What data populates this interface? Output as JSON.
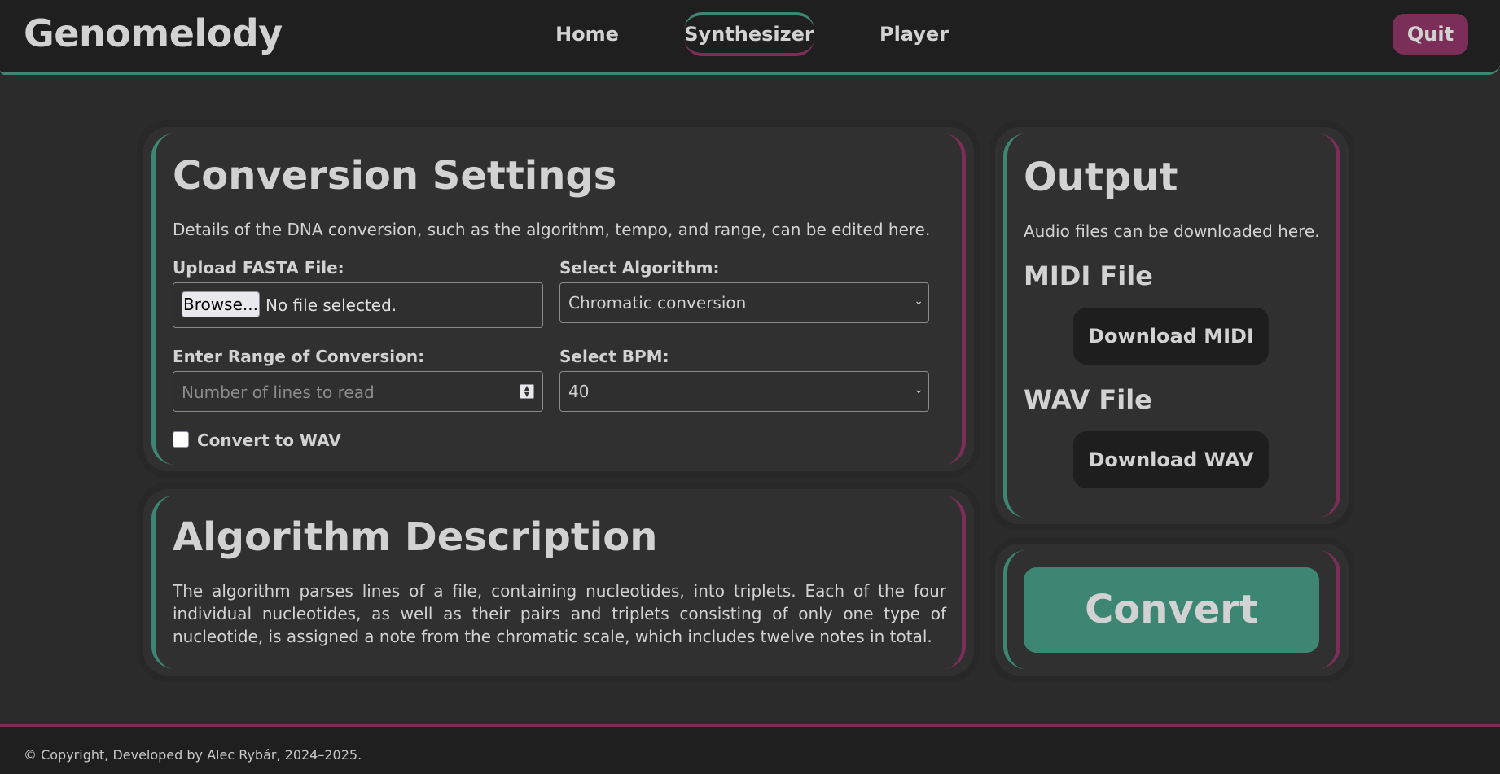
{
  "header": {
    "logo": "Genomelody",
    "nav": [
      {
        "label": "Home"
      },
      {
        "label": "Synthesizer",
        "active": true
      },
      {
        "label": "Player"
      }
    ],
    "quit_label": "Quit"
  },
  "settings": {
    "title": "Conversion Settings",
    "description": "Details of the DNA conversion, such as the algorithm, tempo, and range, can be edited here.",
    "upload_label": "Upload FASTA File:",
    "browse_label": "Browse...",
    "no_file_text": "No file selected.",
    "algorithm_label": "Select Algorithm:",
    "algorithm_value": "Chromatic conversion",
    "range_label": "Enter Range of Conversion:",
    "range_placeholder": "Number of lines to read",
    "bpm_label": "Select BPM:",
    "bpm_value": "40",
    "wav_checkbox_label": "Convert to WAV",
    "wav_checked": false
  },
  "algorithm": {
    "title": "Algorithm Description",
    "text": "The algorithm parses lines of a file, containing nucleotides, into triplets. Each of the four individual nucleotides, as well as their pairs and triplets consisting of only one type of nucleotide, is assigned a note from the chromatic scale, which includes twelve notes in total."
  },
  "output": {
    "title": "Output",
    "description": "Audio files can be downloaded here.",
    "midi_heading": "MIDI File",
    "midi_button": "Download MIDI",
    "wav_heading": "WAV File",
    "wav_button": "Download WAV"
  },
  "convert_label": "Convert",
  "footer": {
    "text": "© Copyright, Developed by Alec Rybár, 2024–2025."
  },
  "colors": {
    "accent_green": "#3e8674",
    "accent_magenta": "#7a2e58",
    "background": "#2b2b2b",
    "header_bg": "#1f1f1f"
  }
}
